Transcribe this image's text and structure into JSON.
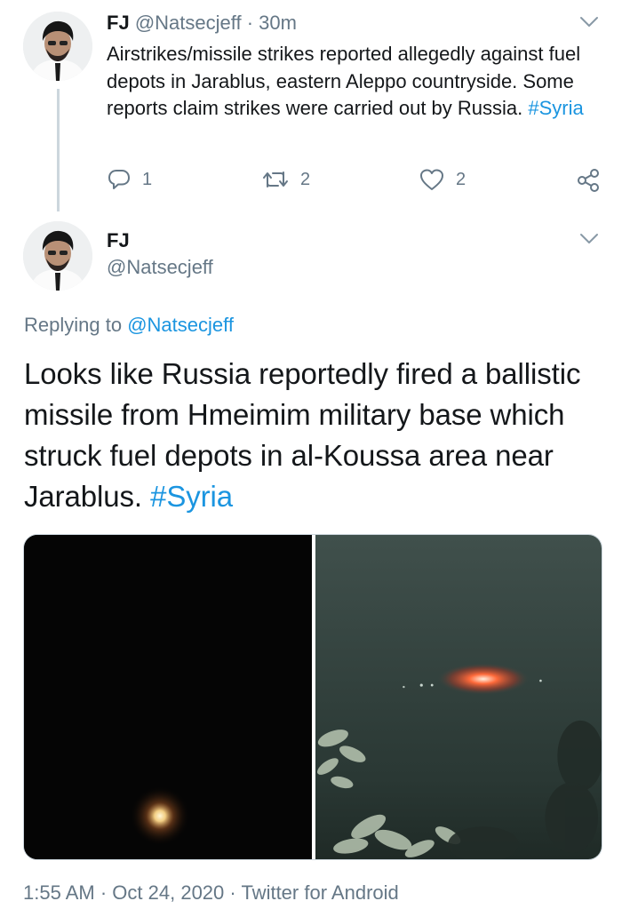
{
  "tweet1": {
    "display_name": "FJ",
    "handle": "@Natsecjeff",
    "separator": "·",
    "time": "30m",
    "text": "Airstrikes/missile strikes reported allegedly against fuel depots in Jarablus, eastern Aleppo countryside. Some reports claim strikes were carried out by Russia.",
    "hashtag": "#Syria",
    "actions": {
      "reply_count": "1",
      "retweet_count": "2",
      "like_count": "2"
    }
  },
  "tweet2": {
    "display_name": "FJ",
    "handle": "@Natsecjeff",
    "replying_prefix": "Replying to",
    "replying_to": "@Natsecjeff",
    "text": "Looks like Russia reportedly fired a ballistic missile from Hmeimim military base which struck fuel depots in al-Koussa area near Jarablus.",
    "hashtag": "#Syria",
    "footer": {
      "time": "1:55 AM",
      "separator": "·",
      "date": "Oct 24, 2020",
      "source": "Twitter for Android"
    }
  },
  "colors": {
    "link": "#1b95e0",
    "muted": "#657786",
    "text": "#14171a",
    "divider": "#ccd6dd"
  },
  "icons": [
    "chevron-down-icon",
    "reply-icon",
    "retweet-icon",
    "like-icon",
    "share-icon"
  ]
}
